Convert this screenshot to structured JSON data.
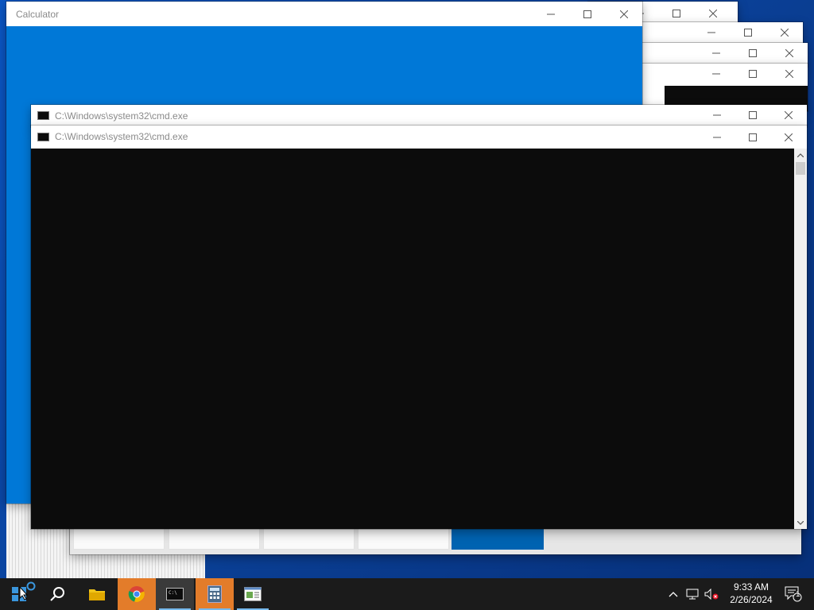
{
  "windows": {
    "calculator": {
      "title": "Calculator"
    },
    "cmd_back": {
      "title": "C:\\Windows\\system32\\cmd.exe"
    },
    "cmd_front": {
      "title": "C:\\Windows\\system32\\cmd.exe"
    }
  },
  "taskbar": {
    "items": [
      {
        "name": "start-button",
        "icon": "windows-logo-icon"
      },
      {
        "name": "search-button",
        "icon": "search-icon"
      },
      {
        "name": "file-explorer",
        "icon": "folder-icon"
      },
      {
        "name": "chrome",
        "icon": "chrome-icon"
      },
      {
        "name": "command-prompt",
        "icon": "cmd-icon"
      },
      {
        "name": "calculator",
        "icon": "calculator-icon"
      },
      {
        "name": "app",
        "icon": "app-window-icon"
      }
    ],
    "clock": {
      "time": "9:33 AM",
      "date": "2/26/2024"
    },
    "notification_count": "1"
  },
  "colors": {
    "calculator_blue": "#0078d7",
    "cmd_background": "#0c0c0c",
    "taskbar": "#1b1b1b",
    "accent": "#0063b1"
  }
}
